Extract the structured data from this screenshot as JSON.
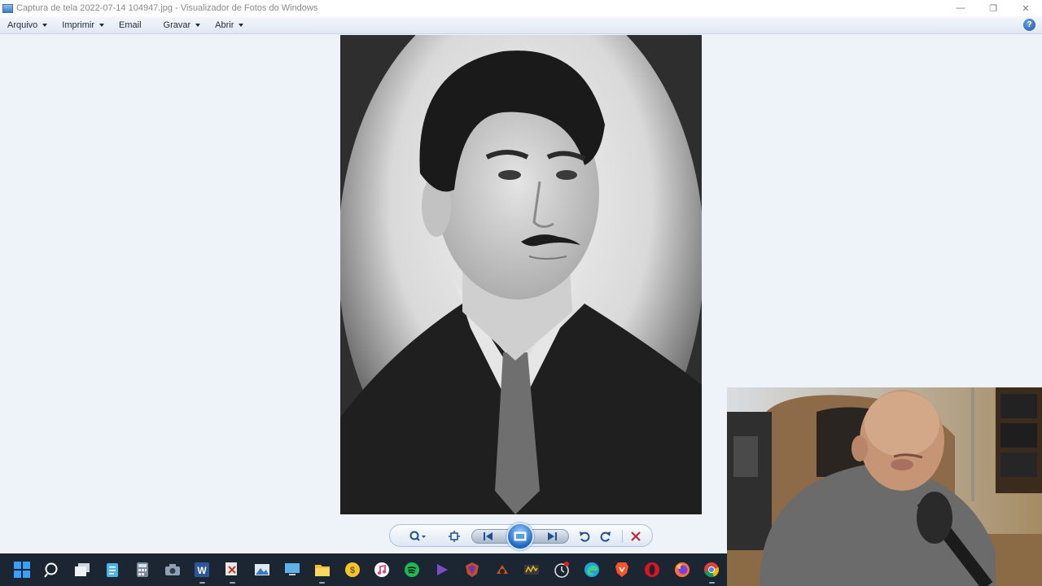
{
  "window": {
    "title": "Captura de tela 2022-07-14 104947.jpg - Visualizador de Fotos do Windows",
    "minimize_glyph": "—",
    "restore_glyph": "❐",
    "close_glyph": "✕"
  },
  "menu": {
    "items": [
      {
        "label": "Arquivo",
        "has_dropdown": true
      },
      {
        "label": "Imprimir",
        "has_dropdown": true
      },
      {
        "label": "Email",
        "has_dropdown": false
      },
      {
        "label": "Gravar",
        "has_dropdown": true
      },
      {
        "label": "Abrir",
        "has_dropdown": true
      }
    ],
    "help_glyph": "?"
  },
  "controls": {
    "icons": [
      "zoom-icon",
      "actual-size-icon",
      "previous-icon",
      "slideshow-icon",
      "next-icon",
      "rotate-left-icon",
      "rotate-right-icon",
      "delete-icon"
    ],
    "delete_color": "#c0262d"
  },
  "taskbar": {
    "icons": [
      "windows-start-icon",
      "search-icon",
      "task-view-icon",
      "notepad-icon",
      "calculator-icon",
      "camera-icon",
      "word-icon",
      "snipping-tool-icon",
      "photos-icon",
      "remote-desktop-icon",
      "file-explorer-icon",
      "coin-app-icon",
      "itunes-icon",
      "spotify-icon",
      "media-player-icon",
      "shield-app-icon",
      "game-app-icon",
      "winamp-icon",
      "clock-app-icon",
      "edge-icon",
      "brave-icon",
      "opera-icon",
      "firefox-icon",
      "chrome-icon"
    ]
  },
  "colors": {
    "background": "#eef3fa",
    "taskbar": "#1c2633",
    "accent": "#1d66c4"
  }
}
